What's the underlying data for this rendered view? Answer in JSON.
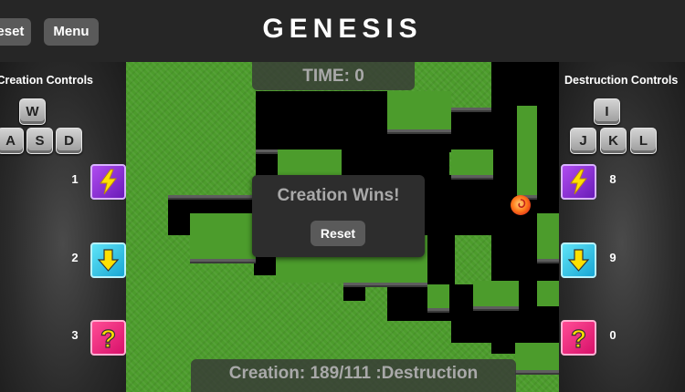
{
  "header": {
    "title": "GENESIS",
    "reset_label": "Reset",
    "menu_label": "Menu"
  },
  "left_panel": {
    "title": "Creation Controls",
    "keys": [
      "W",
      "A",
      "S",
      "D"
    ],
    "powerups": [
      {
        "count": "1",
        "icon": "lightning-bolt-icon",
        "color": "#8a2be2"
      },
      {
        "count": "2",
        "icon": "arrow-down-icon",
        "color": "#2ec4ea"
      },
      {
        "count": "3",
        "icon": "question-mark-icon",
        "color": "#ee2a7b"
      }
    ]
  },
  "right_panel": {
    "title": "Destruction Controls",
    "keys": [
      "I",
      "J",
      "K",
      "L"
    ],
    "powerups": [
      {
        "count": "8",
        "icon": "lightning-bolt-icon",
        "color": "#8a2be2"
      },
      {
        "count": "9",
        "icon": "arrow-down-icon",
        "color": "#2ec4ea"
      },
      {
        "count": "0",
        "icon": "question-mark-icon",
        "color": "#ee2a7b"
      }
    ]
  },
  "game": {
    "time_text": "TIME: 0",
    "score_text": "Creation: 189/111 :Destruction",
    "result_text": "Creation Wins!",
    "result_button": "Reset"
  },
  "colors": {
    "grass": "#4c9c2c",
    "void": "#000000",
    "panel": "#2d2d2d",
    "bolt": "#8a2be2",
    "arrow": "#2ec4ea",
    "question": "#ee2a7b"
  }
}
